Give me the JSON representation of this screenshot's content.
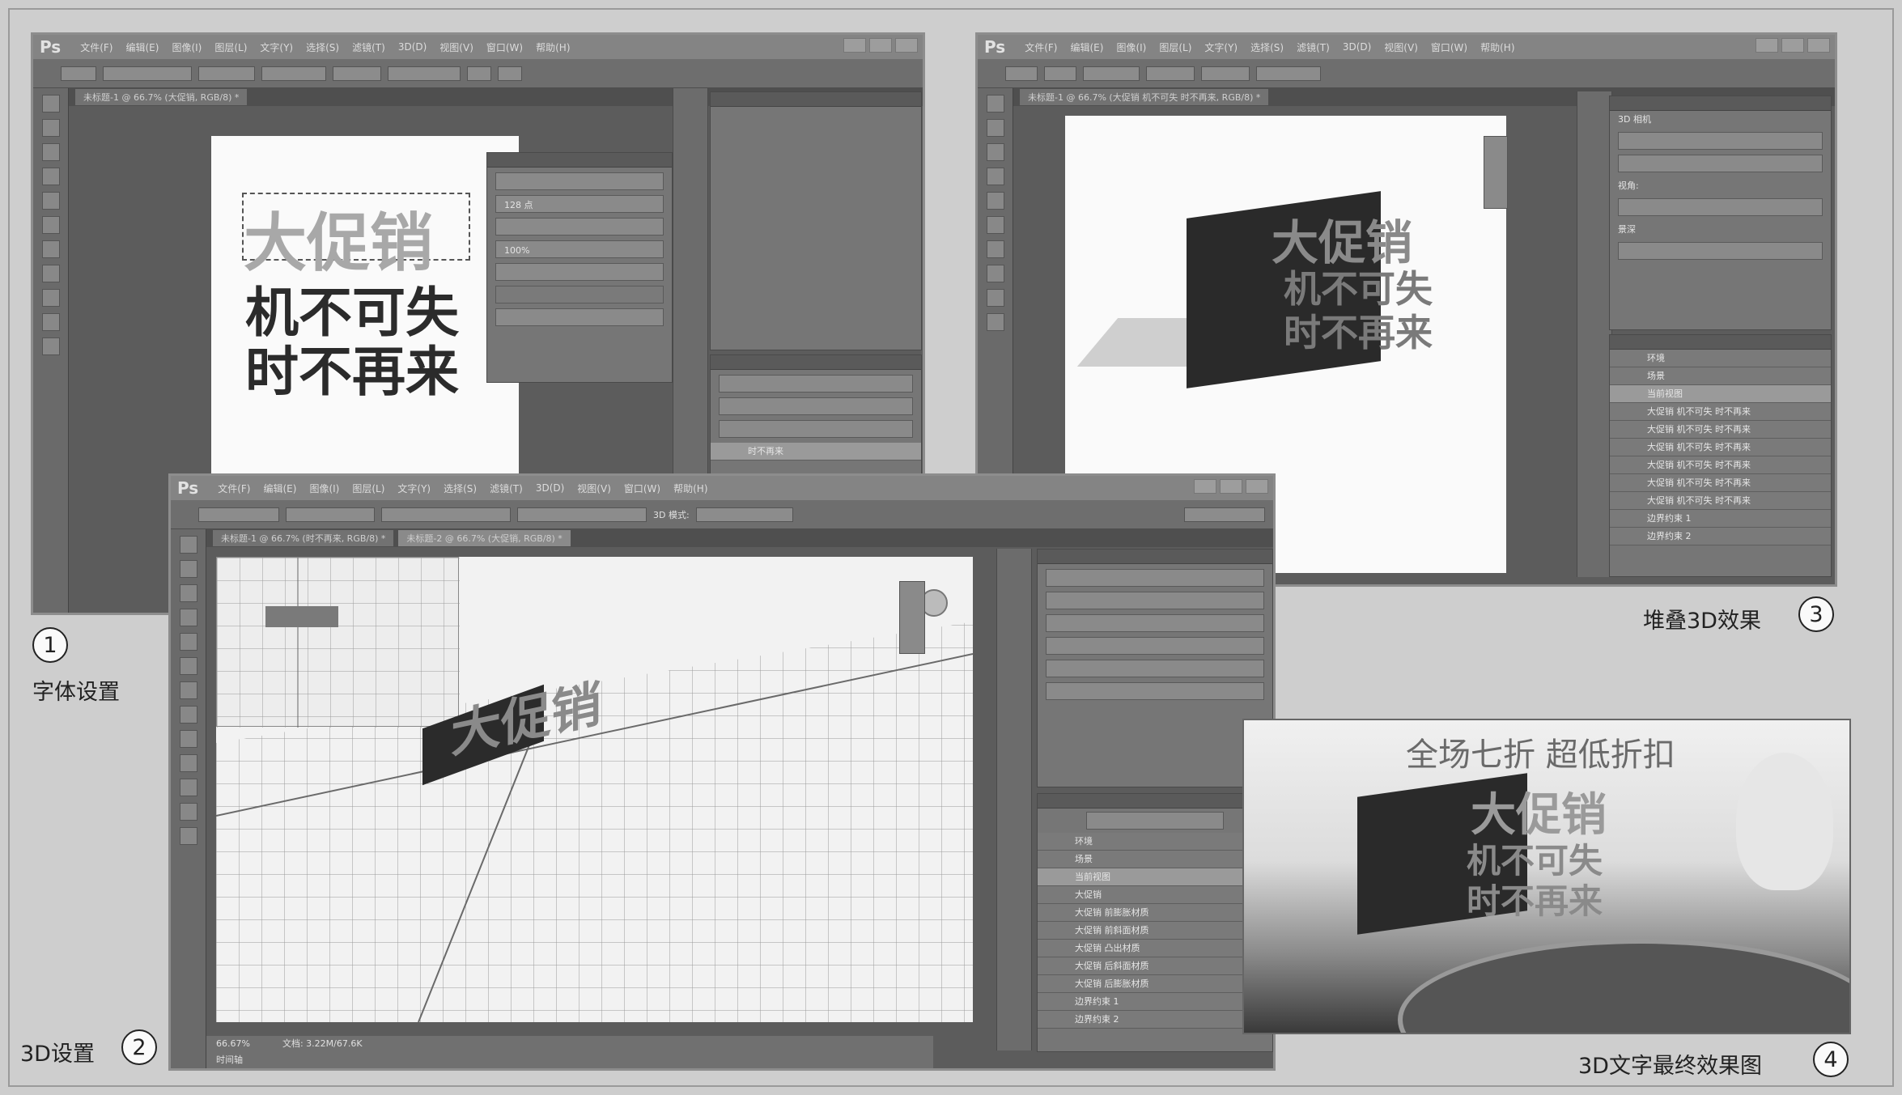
{
  "menu_items": [
    "文件(F)",
    "编辑(E)",
    "图像(I)",
    "图层(L)",
    "文字(Y)",
    "选择(S)",
    "滤镜(T)",
    "3D(D)",
    "视图(V)",
    "窗口(W)",
    "帮助(H)"
  ],
  "app_logo": "Ps",
  "step1": {
    "tab": "未标题-1 @ 66.7% (大促销, RGB/8) *",
    "line1": "大促销",
    "line2": "机不可失",
    "line3": "时不再来",
    "caption": "字体设置",
    "number": "1",
    "font_size": "128 点",
    "scale": "100%"
  },
  "step2": {
    "tab1": "未标题-1 @ 66.7% (时不再来, RGB/8) *",
    "tab2": "未标题-2 @ 66.7% (大促销, RGB/8) *",
    "text3d": "大促销",
    "caption": "3D设置",
    "number": "2",
    "zoom": "66.67%",
    "status_doc": "文档: 3.22M/67.6K",
    "timeline": "时间轴",
    "mode_3d": "3D 模式:",
    "layers": [
      "环境",
      "场景",
      "当前视图",
      "大促销",
      "大促销 前膨胀材质",
      "大促销 前斜面材质",
      "大促销 凸出材质",
      "大促销 后斜面材质",
      "大促销 后膨胀材质",
      "边界约束 1",
      "边界约束 2"
    ]
  },
  "step3": {
    "tab": "未标题-1 @ 66.7% (大促销 机不可失 时不再来, RGB/8) *",
    "line1": "大促销",
    "line2": "机不可失",
    "line3": "时不再来",
    "caption": "堆叠3D效果",
    "number": "3",
    "layers": [
      "环境",
      "场景",
      "当前视图",
      "大促销 机不可失 时不再来",
      "大促销 机不可失 时不再来",
      "大促销 机不可失 时不再来",
      "大促销 机不可失 时不再来",
      "大促销 机不可失 时不再来",
      "大促销 机不可失 时不再来",
      "边界约束 1",
      "边界约束 2"
    ],
    "camera": "3D 相机",
    "fov": "视角:",
    "depth": "景深"
  },
  "step4": {
    "headline": "全场七折 超低折扣",
    "line1": "大促销",
    "line2": "机不可失",
    "line3": "时不再来",
    "caption": "3D文字最终效果图",
    "number": "4"
  },
  "colors": {
    "frame_bg": "#cecece",
    "ui_dark": "#5c5c5c",
    "doc_white": "#fafafa"
  }
}
